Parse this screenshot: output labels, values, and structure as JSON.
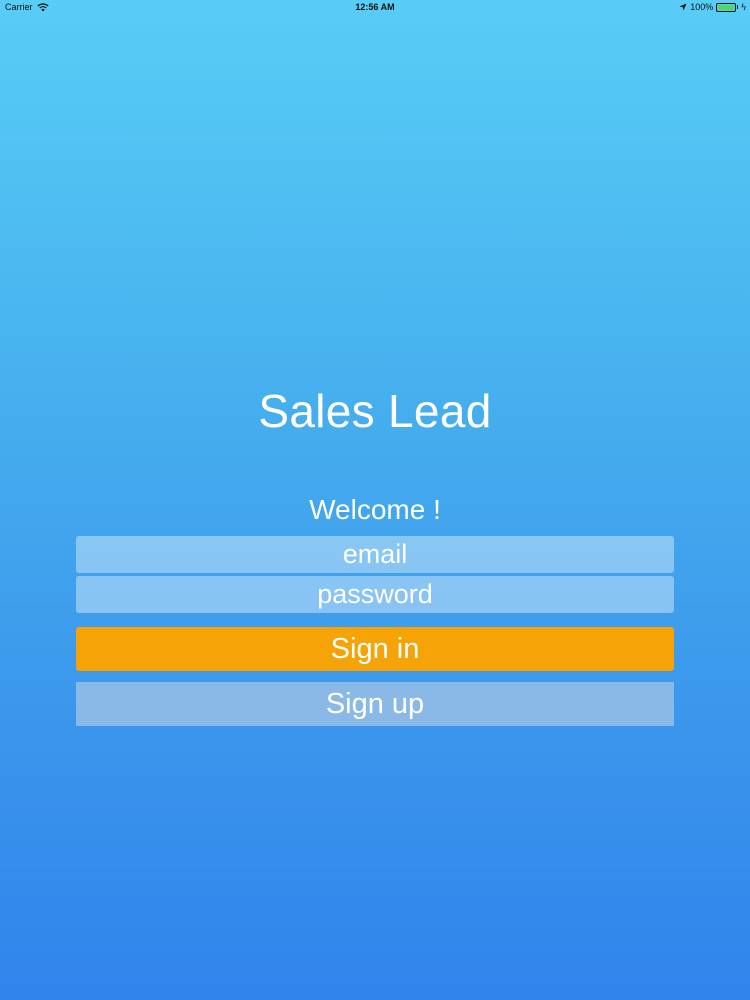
{
  "status_bar": {
    "carrier": "Carrier",
    "time": "12:56 AM",
    "battery_percent": "100%",
    "battery_level": 1.0,
    "battery_color": "#4cd964",
    "icons": [
      "wifi-icon",
      "location-icon",
      "battery-icon",
      "charging-icon"
    ]
  },
  "app": {
    "title": "Sales Lead",
    "welcome": "Welcome !"
  },
  "form": {
    "email_placeholder": "email",
    "email_value": "",
    "password_placeholder": "password",
    "password_value": "",
    "signin_label": "Sign in",
    "signup_label": "Sign up"
  },
  "colors": {
    "background_top": "#58cdf6",
    "background_bottom": "#3184ec",
    "signin_button": "#f5a306",
    "signup_button": "#8ab9e8",
    "text": "#ffffff"
  }
}
